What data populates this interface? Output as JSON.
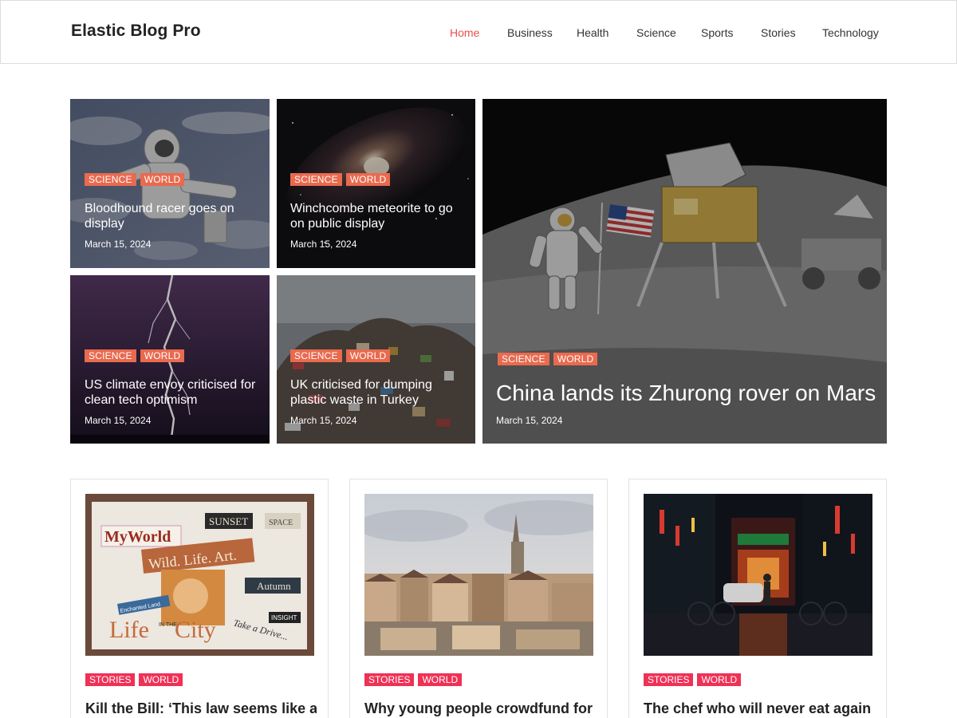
{
  "site": {
    "title": "Elastic Blog Pro"
  },
  "nav": {
    "items": [
      {
        "label": "Home",
        "active": true
      },
      {
        "label": "Business"
      },
      {
        "label": "Health"
      },
      {
        "label": "Science"
      },
      {
        "label": "Sports"
      },
      {
        "label": "Stories"
      },
      {
        "label": "Technology"
      }
    ]
  },
  "featured": [
    {
      "title": "Bloodhound racer goes on display",
      "date": "March 15, 2024",
      "tags": [
        "SCIENCE",
        "WORLD"
      ]
    },
    {
      "title": "Winchcombe meteorite to go on public display",
      "date": "March 15, 2024",
      "tags": [
        "SCIENCE",
        "WORLD"
      ]
    },
    {
      "title": "US climate envoy criticised for clean tech optimism",
      "date": "March 15, 2024",
      "tags": [
        "SCIENCE",
        "WORLD"
      ]
    },
    {
      "title": "UK criticised for dumping plastic waste in Turkey",
      "date": "March 15, 2024",
      "tags": [
        "SCIENCE",
        "WORLD"
      ]
    },
    {
      "title": "China lands its Zhurong rover on Mars",
      "date": "March 15, 2024",
      "tags": [
        "SCIENCE",
        "WORLD"
      ]
    }
  ],
  "cards": [
    {
      "title": "Kill the Bill: ‘This law seems like a",
      "tags": [
        "STORIES",
        "WORLD"
      ]
    },
    {
      "title": "Why young people crowdfund for",
      "tags": [
        "STORIES",
        "WORLD"
      ]
    },
    {
      "title": "The chef who will never eat again",
      "tags": [
        "STORIES",
        "WORLD"
      ]
    }
  ],
  "collage_words": {
    "myworld": "MyWorld",
    "sunset": "SUNSET",
    "space": "SPACE",
    "wildlife": "Wild. Life. Art.",
    "autumn": "Autumn",
    "enchanted": "Enchanted Land",
    "life": "Life",
    "inthe": "IN THE",
    "city": "City",
    "takeadrive": "Take a Drive...",
    "insight": "INSIGHT"
  },
  "colors": {
    "accent_nav": "#e8504a",
    "featured_tag": "#e96a4e",
    "card_tag": "#ef3156"
  }
}
